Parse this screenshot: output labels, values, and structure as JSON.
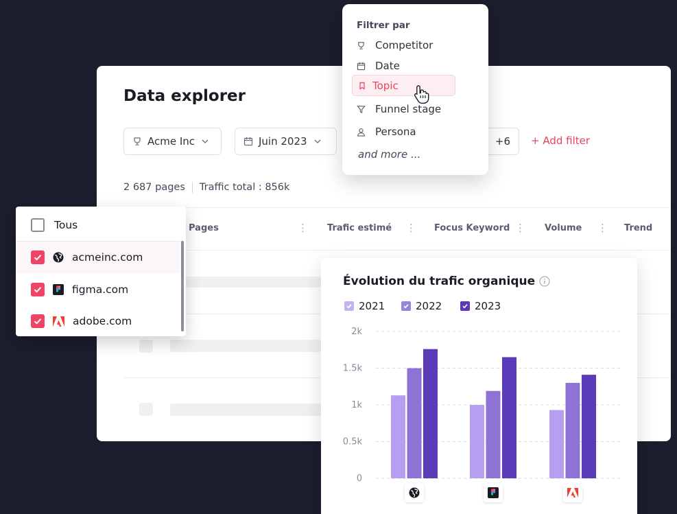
{
  "main": {
    "title": "Data explorer",
    "filters": {
      "competitor_chip": "Acme Inc",
      "date_chip": "Juin 2023",
      "more_count": "+6",
      "add_filter": "+ Add filter"
    },
    "stats": {
      "pages": "2 687 pages",
      "traffic": "Traffic total : 856k"
    },
    "table_headers": [
      "Pages",
      "Trafic estimé",
      "Focus Keyword",
      "Volume",
      "Trend"
    ]
  },
  "filter_menu": {
    "title": "Filtrer par",
    "items": [
      {
        "label": "Competitor",
        "icon": "trophy-icon"
      },
      {
        "label": "Date",
        "icon": "calendar-icon"
      },
      {
        "label": "Topic",
        "icon": "bookmark-icon"
      },
      {
        "label": "Funnel stage",
        "icon": "funnel-icon"
      },
      {
        "label": "Persona",
        "icon": "user-icon"
      }
    ],
    "more": "and more ..."
  },
  "domains": {
    "all_label": "Tous",
    "items": [
      {
        "label": "acmeinc.com",
        "checked": true,
        "icon": "globe-icon"
      },
      {
        "label": "figma.com",
        "checked": true,
        "icon": "figma-logo-icon"
      },
      {
        "label": "adobe.com",
        "checked": true,
        "icon": "adobe-logo-icon"
      }
    ]
  },
  "colors": {
    "accent": "#f04466",
    "c2021": "#b89ef0",
    "c2022": "#8e72d6",
    "c2023": "#5b3bb7"
  },
  "chart_data": {
    "type": "bar",
    "title": "Évolution du trafic organique",
    "categories": [
      "acmeinc.com",
      "figma.com",
      "adobe.com"
    ],
    "series": [
      {
        "name": "2021",
        "values": [
          1130,
          1000,
          930
        ]
      },
      {
        "name": "2022",
        "values": [
          1500,
          1190,
          1300
        ]
      },
      {
        "name": "2023",
        "values": [
          1760,
          1650,
          1410
        ]
      }
    ],
    "yticks": [
      "0",
      "0.5k",
      "1k",
      "1.5k",
      "2k"
    ],
    "ylim": [
      0,
      2000
    ],
    "grid": true,
    "legend": "top-left"
  }
}
